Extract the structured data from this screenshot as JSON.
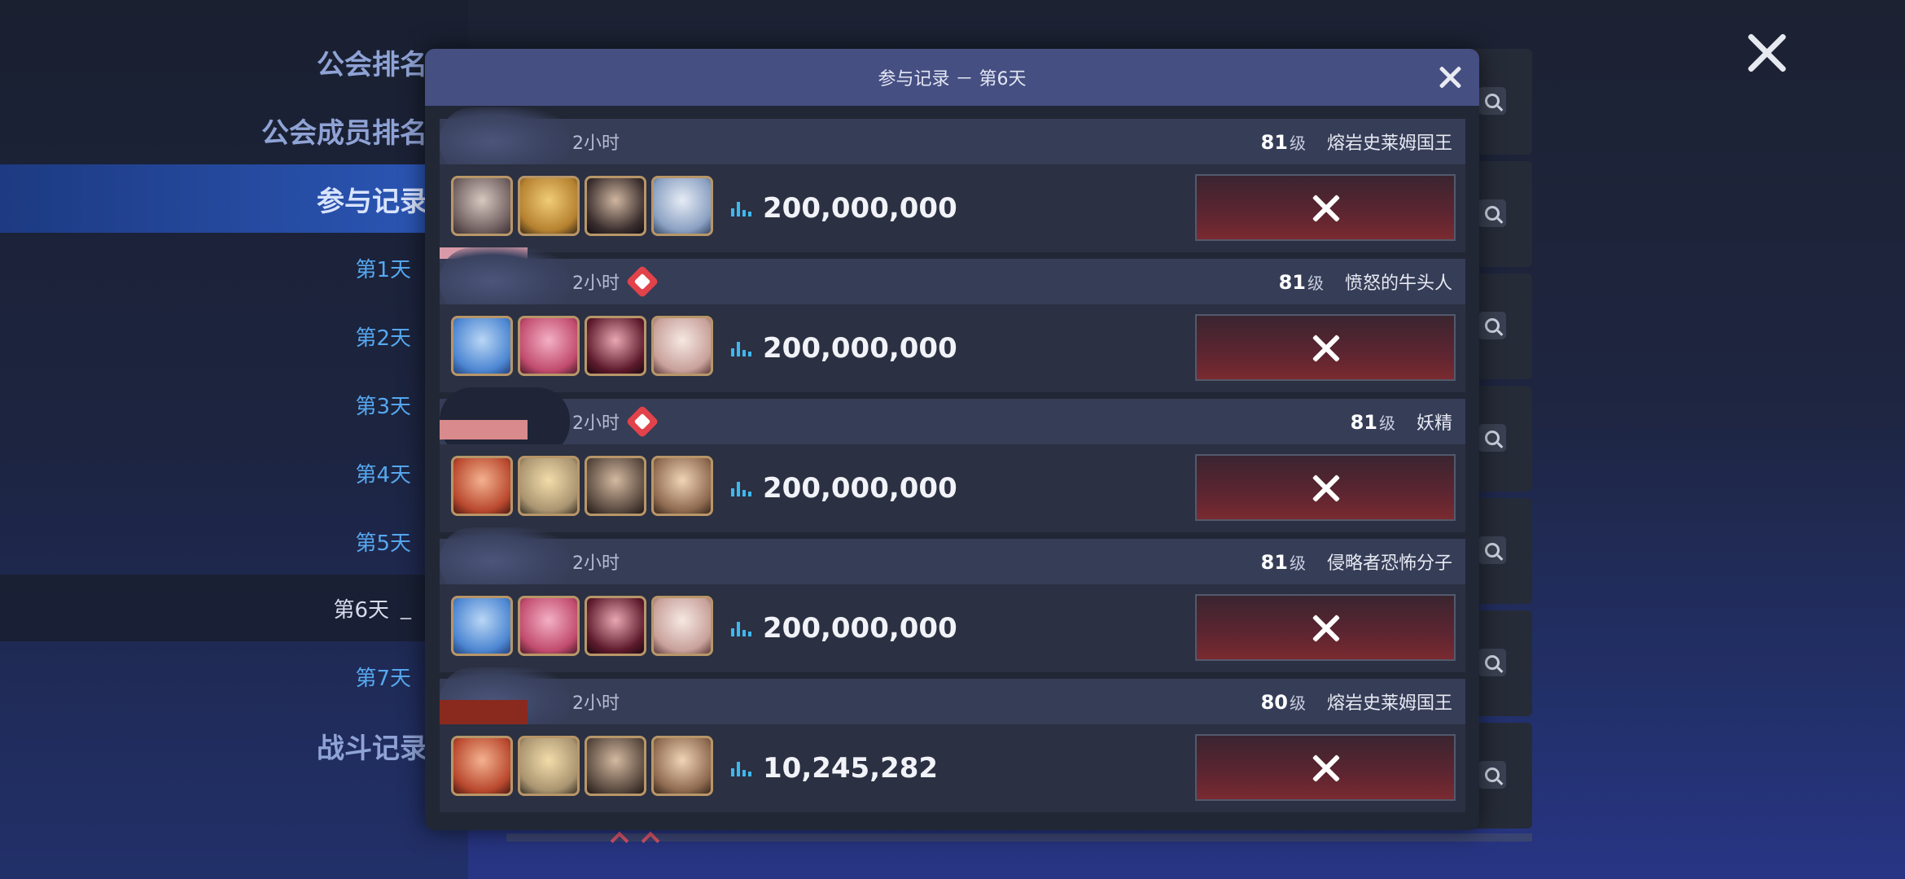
{
  "sidebar": {
    "items": [
      {
        "label": "公会排名"
      },
      {
        "label": "公会成员排名"
      },
      {
        "label": "参与记录"
      }
    ],
    "days": [
      {
        "label": "第1天"
      },
      {
        "label": "第2天"
      },
      {
        "label": "第3天"
      },
      {
        "label": "第4天"
      },
      {
        "label": "第5天"
      },
      {
        "label": "第6天"
      },
      {
        "label": "第7天"
      }
    ],
    "battle_log": {
      "label": "战斗记录"
    }
  },
  "modal": {
    "title": "参与记录 － 第6天",
    "records": [
      {
        "time": "2小时",
        "level": "81",
        "level_unit": "级",
        "boss": "熔岩史莱姆国王",
        "damage": "200,000,000",
        "boss_mark": false
      },
      {
        "time": "2小时",
        "level": "81",
        "level_unit": "级",
        "boss": "愤怒的牛头人",
        "damage": "200,000,000",
        "boss_mark": true
      },
      {
        "time": "2小时",
        "level": "81",
        "level_unit": "级",
        "boss": "妖精",
        "damage": "200,000,000",
        "boss_mark": true
      },
      {
        "time": "2小时",
        "level": "81",
        "level_unit": "级",
        "boss": "侵略者恐怖分子",
        "damage": "200,000,000",
        "boss_mark": false
      },
      {
        "time": "2小时",
        "level": "80",
        "level_unit": "级",
        "boss": "熔岩史莱姆国王",
        "damage": "10,245,282",
        "boss_mark": false
      }
    ]
  },
  "icons": {
    "close": "close-icon",
    "search": "search-icon",
    "damage": "bar-chart-icon",
    "boss_mark": "boss-emblem-icon",
    "defeated": "x-mark-icon"
  },
  "colors": {
    "accent_blue": "#3fb7ef",
    "header_bg": "#454f82",
    "boss_mark": "#e2434a"
  }
}
